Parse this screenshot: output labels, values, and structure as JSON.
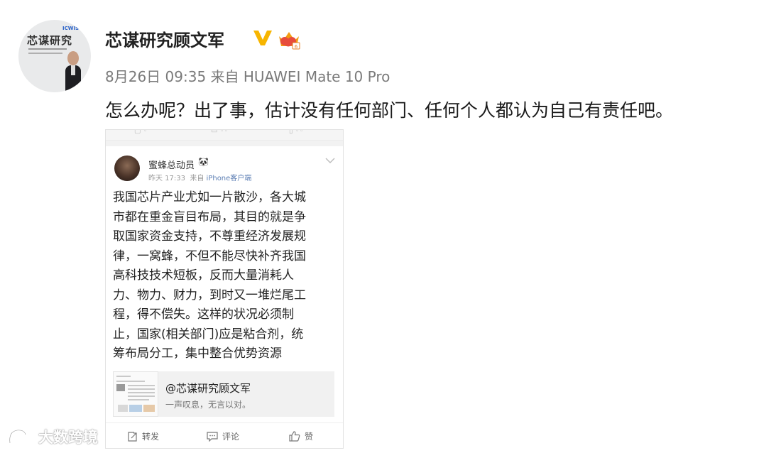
{
  "post": {
    "author": "芯谋研究顾文军",
    "meta": "8月26日 09:35 来自 HUAWEI Mate 10 Pro",
    "text": "怎么办呢？出了事，估计没有任何部门、任何个人都认为自己有责任吧。",
    "avatar_caption": "芯谋研究",
    "avatar_brand": "ICWISE"
  },
  "embedded": {
    "author": "蜜蜂总动员",
    "time": "昨天 17:33",
    "via": "来自",
    "source": "iPhone客户端",
    "body": "我国芯片产业尤如一片散沙，各大城\n市都在重金盲目布局，其目的就是争\n取国家资金支持，不尊重经济发展规\n律，一窝蜂，不但不能尽快补齐我国\n高科技技术短板，反而大量消耗人\n力、物力、财力，到时又一堆烂尾工\n程，得不偿失。这样的状况必须制\n止，国家(相关部门)应是粘合剂，统\n筹布局分工，集中整合优势资源",
    "quote": {
      "title": "@芯谋研究顾文军",
      "subtitle": "一声叹息，无言以对。"
    },
    "actions": {
      "repost": "转发",
      "comment": "评论",
      "like": "赞"
    }
  },
  "watermark": "大数跨境",
  "colors": {
    "verified_badge": "#f7b500",
    "link_blue": "#5d7fb4",
    "meta_gray": "#7a7a7a"
  }
}
